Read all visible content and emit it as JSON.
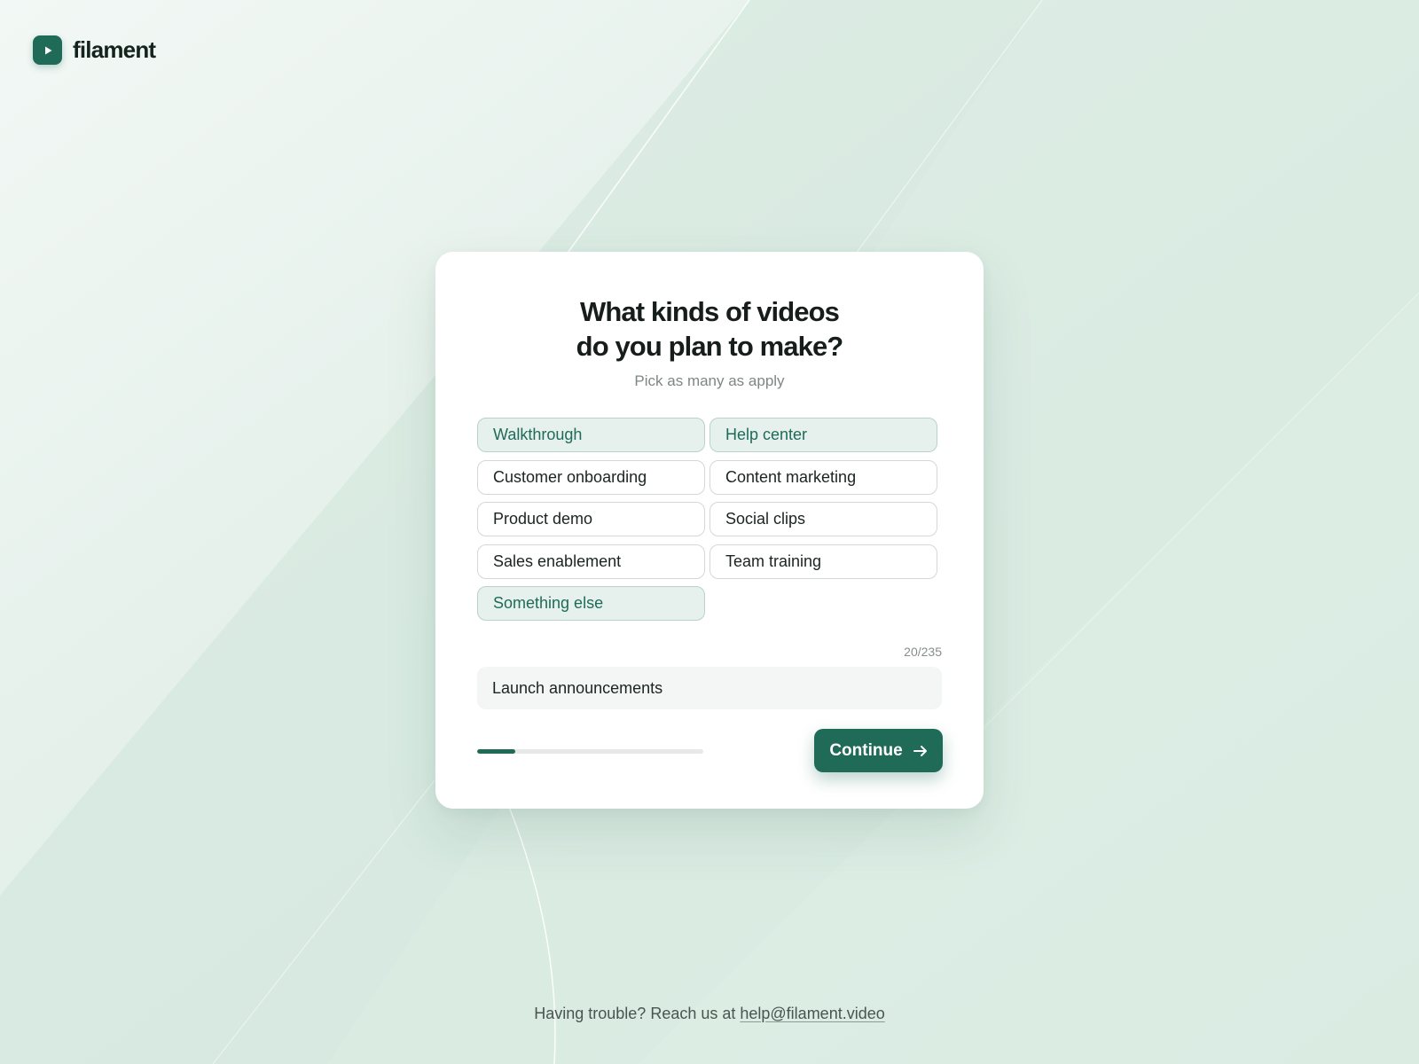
{
  "brand": {
    "name": "filament",
    "icon": "play-icon",
    "color": "#1f6b58"
  },
  "card": {
    "title_line1": "What kinds of videos",
    "title_line2": "do you plan to make?",
    "subtitle": "Pick as many as apply"
  },
  "options": [
    {
      "label": "Walkthrough",
      "selected": true
    },
    {
      "label": "Help center",
      "selected": true
    },
    {
      "label": "Customer onboarding",
      "selected": false
    },
    {
      "label": "Content marketing",
      "selected": false
    },
    {
      "label": "Product demo",
      "selected": false
    },
    {
      "label": "Social clips",
      "selected": false
    },
    {
      "label": "Sales enablement",
      "selected": false
    },
    {
      "label": "Team training",
      "selected": false
    },
    {
      "label": "Something else",
      "selected": true
    }
  ],
  "other_input": {
    "value": "Launch announcements",
    "counter": "20/235"
  },
  "progress": {
    "fraction": 0.17
  },
  "continue_button": {
    "label": "Continue",
    "icon": "arrow-right-icon"
  },
  "footer": {
    "text": "Having trouble? Reach us at ",
    "email": "help@filament.video"
  },
  "colors": {
    "accent": "#1f6b58",
    "selected_bg": "#e6f0ec",
    "page_bg": "#e3efea"
  }
}
